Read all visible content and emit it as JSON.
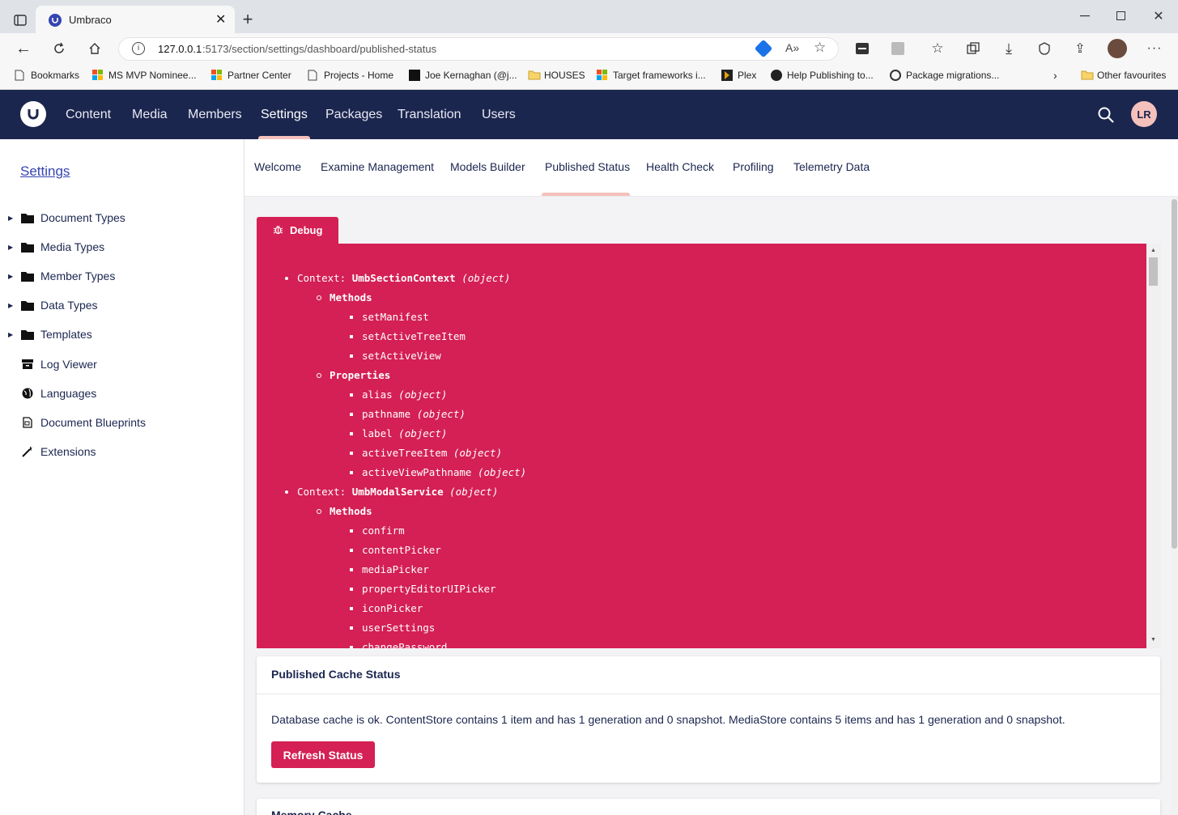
{
  "browser": {
    "tab_title": "Umbraco",
    "url_host": "127.0.0.1",
    "url_rest": ":5173/section/settings/dashboard/published-status",
    "bookmarks": [
      "Bookmarks",
      "MS MVP Nominee...",
      "Partner Center",
      "Projects - Home",
      "Joe Kernaghan (@j...",
      "HOUSES",
      "Target frameworks i...",
      "Plex",
      "Help Publishing to...",
      "Package migrations..."
    ],
    "other_favourites": "Other favourites"
  },
  "header": {
    "logo": "U",
    "sections": [
      "Content",
      "Media",
      "Members",
      "Settings",
      "Packages",
      "Translation",
      "Users"
    ],
    "active_section": "Settings",
    "avatar_initials": "LR"
  },
  "sidebar": {
    "title": "Settings",
    "items": [
      {
        "label": "Document Types",
        "icon": "folder-icon",
        "expandable": true
      },
      {
        "label": "Media Types",
        "icon": "folder-icon",
        "expandable": true
      },
      {
        "label": "Member Types",
        "icon": "folder-icon",
        "expandable": true
      },
      {
        "label": "Data Types",
        "icon": "folder-icon",
        "expandable": true
      },
      {
        "label": "Templates",
        "icon": "folder-icon",
        "expandable": true
      },
      {
        "label": "Log Viewer",
        "icon": "box-icon",
        "expandable": false
      },
      {
        "label": "Languages",
        "icon": "globe-icon",
        "expandable": false
      },
      {
        "label": "Document Blueprints",
        "icon": "blueprint-icon",
        "expandable": false
      },
      {
        "label": "Extensions",
        "icon": "wand-icon",
        "expandable": false
      }
    ]
  },
  "dashboard": {
    "tabs": [
      "Welcome",
      "Examine Management",
      "Models Builder",
      "Published Status",
      "Health Check",
      "Profiling",
      "Telemetry Data"
    ],
    "active_tab": "Published Status"
  },
  "debug": {
    "tab_label": "Debug",
    "lines": [
      {
        "level": 1,
        "prefix": "Context: ",
        "name": "UmbSectionContext",
        "type": "(object)"
      },
      {
        "level": 2,
        "label": "Methods"
      },
      {
        "level": 3,
        "name": "setManifest"
      },
      {
        "level": 3,
        "name": "setActiveTreeItem"
      },
      {
        "level": 3,
        "name": "setActiveView"
      },
      {
        "level": 2,
        "label": "Properties"
      },
      {
        "level": 3,
        "name": "alias",
        "type": "(object)"
      },
      {
        "level": 3,
        "name": "pathname",
        "type": "(object)"
      },
      {
        "level": 3,
        "name": "label",
        "type": "(object)"
      },
      {
        "level": 3,
        "name": "activeTreeItem",
        "type": "(object)"
      },
      {
        "level": 3,
        "name": "activeViewPathname",
        "type": "(object)"
      },
      {
        "level": 1,
        "prefix": "Context: ",
        "name": "UmbModalService",
        "type": "(object)"
      },
      {
        "level": 2,
        "label": "Methods"
      },
      {
        "level": 3,
        "name": "confirm"
      },
      {
        "level": 3,
        "name": "contentPicker"
      },
      {
        "level": 3,
        "name": "mediaPicker"
      },
      {
        "level": 3,
        "name": "propertyEditorUIPicker"
      },
      {
        "level": 3,
        "name": "iconPicker"
      },
      {
        "level": 3,
        "name": "userSettings"
      },
      {
        "level": 3,
        "name": "changePassword"
      }
    ]
  },
  "published_cache": {
    "title": "Published Cache Status",
    "message": "Database cache is ok. ContentStore contains 1 item and has 1 generation and 0 snapshot. MediaStore contains 5 items and has 1 generation and 0 snapshot.",
    "refresh_label": "Refresh Status"
  },
  "memory_cache": {
    "title": "Memory Cache"
  },
  "colors": {
    "brand_navy": "#1b264f",
    "accent_pink": "#d42054",
    "indicator": "#f5c1bc"
  }
}
